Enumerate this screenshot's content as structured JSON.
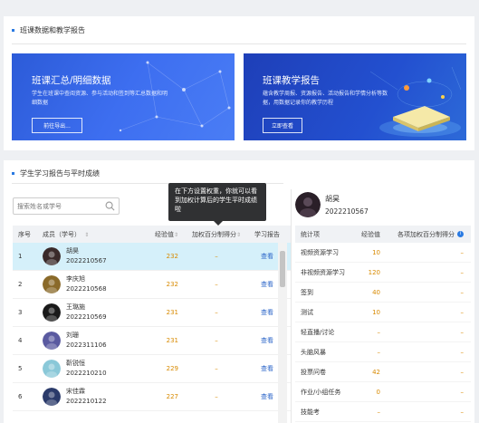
{
  "top_section": {
    "title": "班课数据和教学报告",
    "banner_left": {
      "title": "班课汇总/明细数据",
      "desc": "学生在班课中查阅资源、参与活动和签到等汇总数据和明细数据",
      "button": "前往导出..."
    },
    "banner_right": {
      "title": "班课教学报告",
      "desc": "蕴含教学周报、资源报告、活动报告和学情分析等数据，用数据记录你的教学历程",
      "button": "立即查看"
    }
  },
  "bottom_section": {
    "title": "学生学习报告与平时成绩",
    "search_placeholder": "搜索姓名或学号",
    "tooltip": "在下方设置权重，你就可以看到加权计算后的学生平时成绩啦",
    "columns": {
      "no": "序号",
      "member": "成员（学号）",
      "sort_icon": "sort-icon",
      "exp": "经验值",
      "pct": "加权百分制得分",
      "report": "学习报告"
    },
    "rows": [
      {
        "no": "1",
        "name": "胡昊",
        "id": "2022210567",
        "exp": "232",
        "pct": "–",
        "report": "查看",
        "selected": true,
        "avatar_color": "#3a2a2a"
      },
      {
        "no": "2",
        "name": "李庆旭",
        "id": "2022210568",
        "exp": "232",
        "pct": "–",
        "report": "查看",
        "selected": false,
        "avatar_color": "#8a6a2a"
      },
      {
        "no": "3",
        "name": "王璐施",
        "id": "2022210569",
        "exp": "231",
        "pct": "–",
        "report": "查看",
        "selected": false,
        "avatar_color": "#1a1a1a"
      },
      {
        "no": "4",
        "name": "刘珊",
        "id": "2022311106",
        "exp": "231",
        "pct": "–",
        "report": "查看",
        "selected": false,
        "avatar_color": "#5a5aa0"
      },
      {
        "no": "5",
        "name": "靳锐恒",
        "id": "2022210210",
        "exp": "229",
        "pct": "–",
        "report": "查看",
        "selected": false,
        "avatar_color": "#8ac8d8"
      },
      {
        "no": "6",
        "name": "宋佳霖",
        "id": "2022210122",
        "exp": "227",
        "pct": "–",
        "report": "查看",
        "selected": false,
        "avatar_color": "#2a3a6a"
      }
    ]
  },
  "detail": {
    "name": "胡昊",
    "id": "2022210567",
    "columns": {
      "item": "统计项",
      "exp": "经验值",
      "score": "各项加权百分制得分",
      "info_icon": "info-icon"
    },
    "rows": [
      {
        "item": "视频资源学习",
        "exp": "10",
        "score": "–"
      },
      {
        "item": "非视频资源学习",
        "exp": "120",
        "score": "–"
      },
      {
        "item": "签到",
        "exp": "40",
        "score": "–"
      },
      {
        "item": "测试",
        "exp": "10",
        "score": "–"
      },
      {
        "item": "轻直播/讨论",
        "exp": "–",
        "score": "–"
      },
      {
        "item": "头脑风暴",
        "exp": "–",
        "score": "–"
      },
      {
        "item": "投票问卷",
        "exp": "42",
        "score": "–"
      },
      {
        "item": "作业/小组任务",
        "exp": "0",
        "score": "–"
      },
      {
        "item": "技能考",
        "exp": "–",
        "score": "–"
      }
    ]
  },
  "colors": {
    "accent": "#2a7ae2",
    "value_orange": "#d88a00",
    "selected_row": "#d5f0fa",
    "link": "#2a64c8"
  }
}
